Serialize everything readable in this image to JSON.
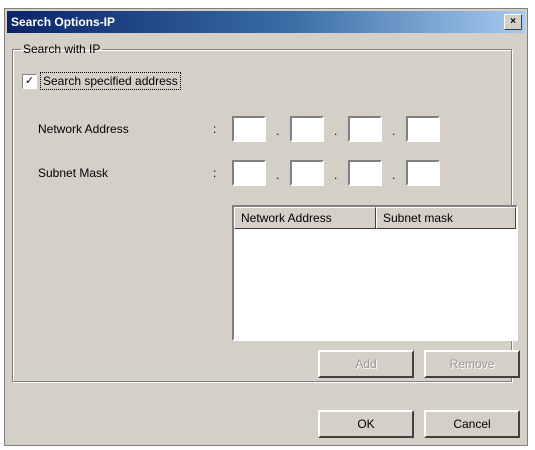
{
  "window": {
    "title": "Search Options-IP",
    "close_glyph": "×"
  },
  "group": {
    "legend": "Search with IP",
    "checkbox": {
      "label": "Search specified address",
      "checked": true,
      "mark": "✓"
    },
    "network_address_label": "Network Address",
    "subnet_mask_label": "Subnet Mask",
    "colon": ":",
    "ip_separator": "."
  },
  "list": {
    "columns": [
      "Network Address",
      "Subnet mask"
    ],
    "rows": []
  },
  "buttons": {
    "add": "Add",
    "remove": "Remove",
    "ok": "OK",
    "cancel": "Cancel"
  }
}
